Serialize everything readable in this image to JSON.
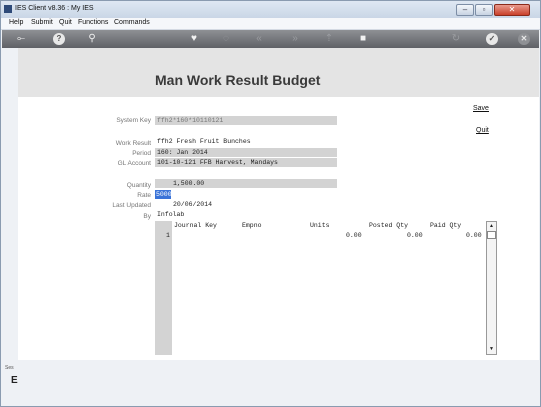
{
  "window": {
    "title": "IES Client v8.36 : My IES"
  },
  "menu": [
    "Help",
    "Submit",
    "Quit",
    "Functions",
    "Commands"
  ],
  "toolbar_icons": [
    "back-icon",
    "help-icon",
    "search-icon",
    "heart-icon",
    "comment-icon",
    "rewind-icon",
    "forward-icon",
    "upload-icon",
    "stop-icon",
    "refresh-icon",
    "check-icon",
    "close-icon"
  ],
  "page": {
    "title": "Man Work Result Budget"
  },
  "actions": {
    "save": "Save",
    "quit": "Quit"
  },
  "fields": {
    "system_key": {
      "label": "System Key",
      "value": "ffh2*160*10110121"
    },
    "work_result": {
      "label": "Work Result",
      "value": "ffh2 Fresh Fruit Bunches"
    },
    "period": {
      "label": "Period",
      "value": "160: Jan 2014"
    },
    "gl_account": {
      "label": "GL Account",
      "value": "101-10-121 FFB Harvest, Mandays"
    },
    "quantity": {
      "label": "Quantity",
      "value": "1,500.00"
    },
    "rate": {
      "label": "Rate",
      "value": "5000"
    },
    "last_updated": {
      "label": "Last Updated",
      "value": "20/06/2014"
    },
    "by": {
      "label": "By",
      "value": "Infolab"
    }
  },
  "grid": {
    "columns": [
      "Journal Key",
      "Empno",
      "Units",
      "Posted Qty",
      "Paid Qty"
    ],
    "rows": [
      {
        "index": "1",
        "journal_key": "",
        "empno": "",
        "units": "0.00",
        "posted_qty": "0.00",
        "paid_qty": "0.00"
      }
    ]
  },
  "side": {
    "label1": "Ses",
    "label2": "E"
  }
}
